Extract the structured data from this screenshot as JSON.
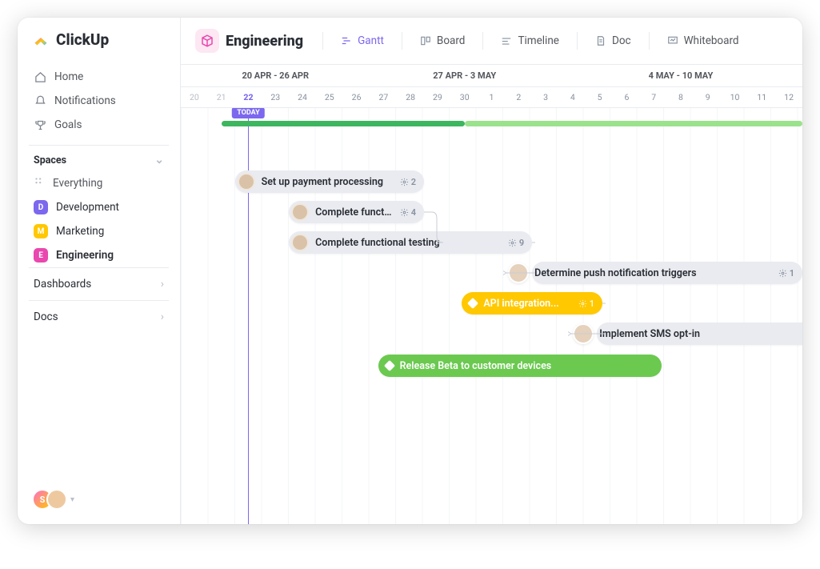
{
  "brand": "ClickUp",
  "nav": {
    "home": "Home",
    "notifications": "Notifications",
    "goals": "Goals"
  },
  "sidebar": {
    "spaces_label": "Spaces",
    "everything": "Everything",
    "spaces": [
      {
        "initial": "D",
        "label": "Development",
        "color": "#7B68EE"
      },
      {
        "initial": "M",
        "label": "Marketing",
        "color": "#FFC800"
      },
      {
        "initial": "E",
        "label": "Engineering",
        "color": "#E948AE"
      }
    ],
    "dashboards": "Dashboards",
    "docs": "Docs",
    "user_initial": "S"
  },
  "header": {
    "space": "Engineering",
    "views": {
      "gantt": "Gantt",
      "board": "Board",
      "timeline": "Timeline",
      "doc": "Doc",
      "whiteboard": "Whiteboard"
    }
  },
  "calendar": {
    "weeks": [
      "20 APR - 26 APR",
      "27 APR - 3 MAY",
      "4 MAY - 10 MAY"
    ],
    "days": [
      "20",
      "21",
      "22",
      "23",
      "24",
      "25",
      "26",
      "27",
      "28",
      "29",
      "30",
      "1",
      "2",
      "3",
      "4",
      "5",
      "6",
      "7",
      "8",
      "9",
      "10",
      "11",
      "12"
    ],
    "today_index": 2,
    "today_label": "TODAY"
  },
  "tasks": [
    {
      "id": "t1",
      "label": "Set up payment processing",
      "count": "2",
      "style": "gray",
      "avatar": true,
      "start": 2,
      "span": 7
    },
    {
      "id": "t2",
      "label": "Complete functio...",
      "count": "4",
      "style": "gray",
      "avatar": true,
      "start": 4,
      "span": 5
    },
    {
      "id": "t3",
      "label": "Complete functional testing",
      "count": "9",
      "style": "gray",
      "avatar": true,
      "start": 4,
      "span": 9
    },
    {
      "id": "t4",
      "label": "Determine push notification triggers",
      "count": "1",
      "style": "gray",
      "lead_avatar": true,
      "start": 13,
      "span": 10
    },
    {
      "id": "t5",
      "label": "API integration...",
      "count": "1",
      "style": "yellow",
      "diamond": true,
      "start": 10.4,
      "span": 5.2
    },
    {
      "id": "t6",
      "label": "Implement SMS opt-in",
      "count": "",
      "style": "gray",
      "lead_avatar": true,
      "start": 15.4,
      "span": 8
    },
    {
      "id": "t7",
      "label": "Release Beta to customer devices",
      "count": "",
      "style": "green",
      "diamond": true,
      "start": 7.3,
      "span": 10.5
    }
  ]
}
